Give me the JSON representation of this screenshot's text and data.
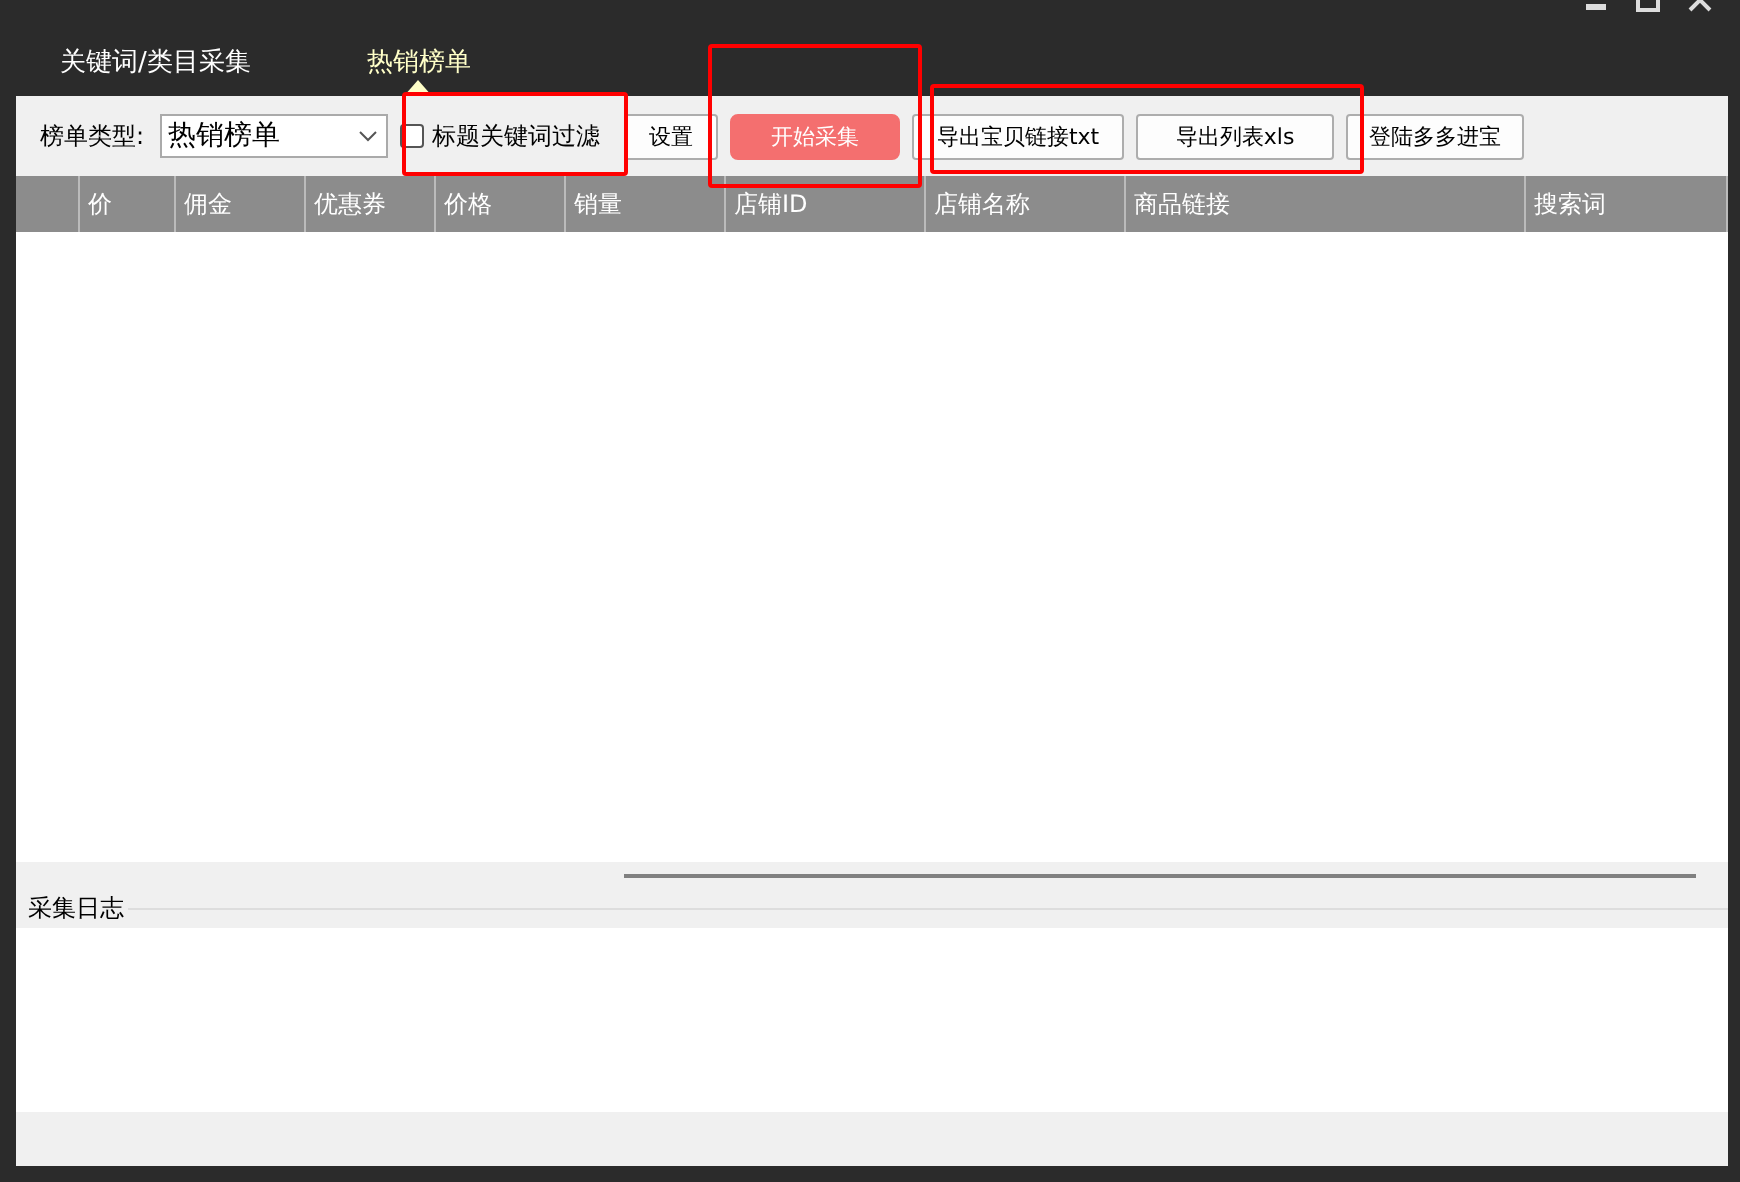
{
  "tabs": [
    {
      "label": "关键词/类目采集",
      "selected": false
    },
    {
      "label": "热销榜单",
      "selected": true
    }
  ],
  "toolbar": {
    "list_type_label": "榜单类型:",
    "list_type_value": "热销榜单",
    "filter": {
      "label": "标题关键词过滤",
      "checked": false
    },
    "buttons": [
      {
        "label": "设置",
        "kind": "plain"
      },
      {
        "label": "开始采集",
        "kind": "primary"
      },
      {
        "label": "导出宝贝链接txt",
        "kind": "plain"
      },
      {
        "label": "导出列表xls",
        "kind": "plain"
      },
      {
        "label": "登陆多多进宝",
        "kind": "plain"
      }
    ]
  },
  "table": {
    "columns": [
      "",
      "价",
      "佣金",
      "优惠券",
      "价格",
      "销量",
      "店铺ID",
      "店铺名称",
      "商品链接",
      "搜索词"
    ]
  },
  "log": {
    "title": "采集日志"
  },
  "annotation_boxes": [
    {
      "color": "#ff0000"
    },
    {
      "color": "#ff0000"
    },
    {
      "color": "#ff0000"
    }
  ]
}
